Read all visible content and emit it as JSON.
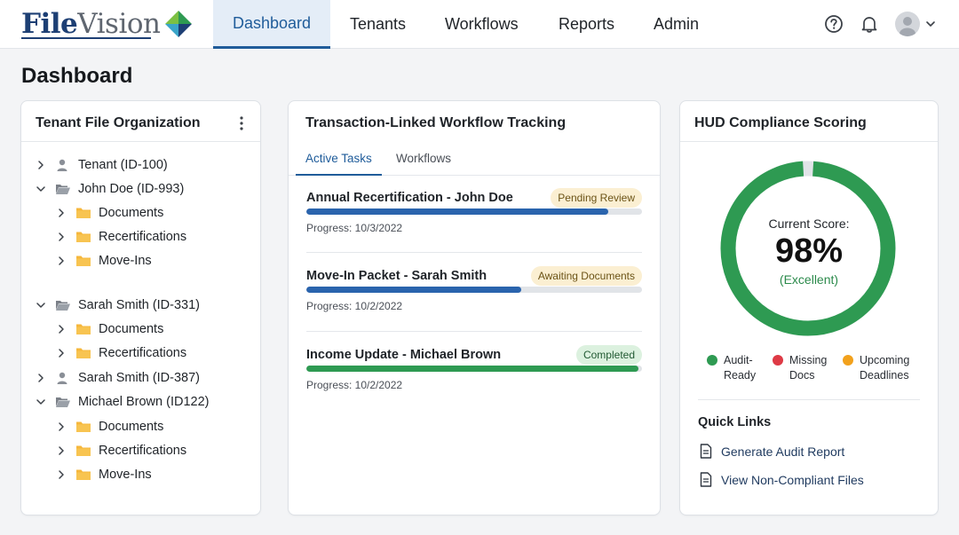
{
  "brand": {
    "name_part1": "File",
    "name_part2": "Vision",
    "colors": {
      "primary": "#1d3f74",
      "accent": "#1f5c9a"
    }
  },
  "nav": {
    "items": [
      {
        "label": "Dashboard",
        "active": true
      },
      {
        "label": "Tenants",
        "active": false
      },
      {
        "label": "Workflows",
        "active": false
      },
      {
        "label": "Reports",
        "active": false
      },
      {
        "label": "Admin",
        "active": false
      }
    ],
    "icons": [
      "help-circle-icon",
      "bell-icon",
      "user-avatar",
      "chevron-down-icon"
    ]
  },
  "page": {
    "title": "Dashboard"
  },
  "tenant_panel": {
    "title": "Tenant File Organization",
    "tree": [
      {
        "label": "Tenant (ID-100)",
        "type": "person",
        "expanded": false,
        "level": 0
      },
      {
        "label": "John Doe (ID-993)",
        "type": "folder-open",
        "expanded": true,
        "level": 0
      },
      {
        "label": "Documents",
        "type": "folder",
        "expanded": false,
        "level": 1
      },
      {
        "label": "Recertifications",
        "type": "folder",
        "expanded": false,
        "level": 1
      },
      {
        "label": "Move-Ins",
        "type": "folder",
        "expanded": false,
        "level": 1
      },
      {
        "label": "Sarah Smith (ID-331)",
        "type": "folder-open",
        "expanded": true,
        "level": 0
      },
      {
        "label": "Documents",
        "type": "folder",
        "expanded": false,
        "level": 1
      },
      {
        "label": "Recertifications",
        "type": "folder",
        "expanded": false,
        "level": 1
      },
      {
        "label": "Sarah Smith (ID-387)",
        "type": "person",
        "expanded": false,
        "level": 0
      },
      {
        "label": "Michael Brown (ID122)",
        "type": "folder-open",
        "expanded": true,
        "level": 0
      },
      {
        "label": "Documents",
        "type": "folder",
        "expanded": false,
        "level": 1
      },
      {
        "label": "Recertifications",
        "type": "folder",
        "expanded": false,
        "level": 1
      },
      {
        "label": "Move-Ins",
        "type": "folder",
        "expanded": false,
        "level": 1
      }
    ]
  },
  "workflow_panel": {
    "title": "Transaction-Linked Workflow Tracking",
    "tabs": [
      {
        "label": "Active Tasks",
        "active": true
      },
      {
        "label": "Workflows",
        "active": false
      }
    ],
    "tasks": [
      {
        "title": "Annual Recertification - John Doe",
        "status": "Pending Review",
        "status_color": "yellow",
        "progress": 0.9,
        "progress_color": "#2a64ad",
        "progress_text": "Progress: 10/3/2022"
      },
      {
        "title": "Move-In Packet - Sarah Smith",
        "status": "Awaiting Documents",
        "status_color": "yellow",
        "progress": 0.64,
        "progress_color": "#2a64ad",
        "progress_text": "Progress: 10/2/2022"
      },
      {
        "title": "Income Update - Michael Brown",
        "status": "Completed",
        "status_color": "green",
        "progress": 0.99,
        "progress_color": "#2e9a52",
        "progress_text": "Progress: 10/2/2022"
      }
    ]
  },
  "compliance_panel": {
    "title": "HUD Compliance Scoring",
    "score_label": "Current Score:",
    "score_value": "98%",
    "score_fraction": 0.98,
    "score_rating": "(Excellent)",
    "gauge_color": "#2e9a52",
    "legend": [
      {
        "line1": "Audit-",
        "line2": "Ready",
        "color": "#2e9a52"
      },
      {
        "line1": "Missing",
        "line2": "Docs",
        "color": "#de3a45"
      },
      {
        "line1": "Upcoming",
        "line2": "Deadlines",
        "color": "#f2a11c"
      }
    ],
    "quick_links_title": "Quick Links",
    "quick_links": [
      {
        "label": "Generate Audit Report"
      },
      {
        "label": "View Non-Compliant Files"
      }
    ]
  }
}
